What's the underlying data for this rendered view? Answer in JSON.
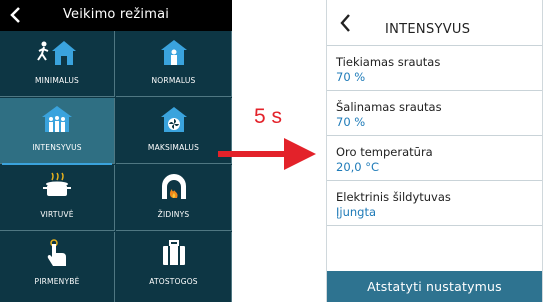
{
  "left_screen": {
    "title": "Veikimo režimai",
    "tiles": [
      {
        "label": "MINIMALUS",
        "icon": "walking-person-house-icon"
      },
      {
        "label": "NORMALUS",
        "icon": "person-house-icon"
      },
      {
        "label": "INTENSYVUS",
        "icon": "group-house-icon",
        "active": true
      },
      {
        "label": "MAKSIMALUS",
        "icon": "fan-house-icon"
      },
      {
        "label": "VIRTUVĖ",
        "icon": "cooking-pot-icon"
      },
      {
        "label": "ŽIDINYS",
        "icon": "fireplace-flame-icon"
      },
      {
        "label": "PIRMENYBĖ",
        "icon": "finger-touch-icon"
      },
      {
        "label": "ATOSTOGOS",
        "icon": "suitcase-icon"
      }
    ]
  },
  "transition": {
    "delay_label": "5 s",
    "arrow_color": "#e3222a"
  },
  "right_screen": {
    "title": "INTENSYVUS",
    "settings": [
      {
        "name": "Tiekiamas srautas",
        "value": "70 %"
      },
      {
        "name": "Šalinamas srautas",
        "value": "70 %"
      },
      {
        "name": "Oro temperatūra",
        "value": "20,0 °C"
      },
      {
        "name": "Elektrinis šildytuvas",
        "value": "Įjungta"
      }
    ],
    "reset_label": "Atstatyti nustatymus"
  },
  "colors": {
    "panel_bg": "#0d3644",
    "active_tile": "#2f6f83",
    "accent_blue": "#1f7bb8",
    "button_bg": "#2e7390"
  }
}
